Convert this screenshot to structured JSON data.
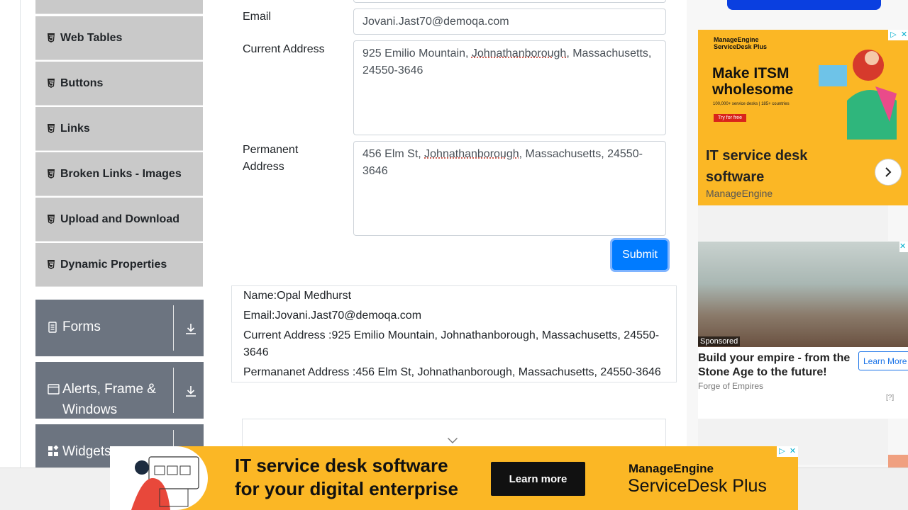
{
  "sidebar": {
    "items": [
      {
        "label": "Web Tables"
      },
      {
        "label": "Buttons"
      },
      {
        "label": "Links"
      },
      {
        "label": "Broken Links - Images"
      },
      {
        "label": "Upload and Download"
      },
      {
        "label": "Dynamic Properties"
      }
    ],
    "groups": [
      {
        "label": "Forms"
      },
      {
        "label": "Alerts, Frame & Windows"
      },
      {
        "label": "Widgets"
      }
    ]
  },
  "form": {
    "email_label": "Email",
    "email_value": "Jovani.Jast70@demoqa.com",
    "current_address_label": "Current Address",
    "current_address_value_pre": "925 Emilio Mountain, ",
    "current_address_value_city": "Johnathanborough",
    "current_address_value_post": ", Massachusetts, 24550-3646",
    "permanent_address_label": "Permanent Address",
    "permanent_address_value_pre": "456 Elm St, ",
    "permanent_address_value_city": "Johnathanborough",
    "permanent_address_value_post": ", Massachusetts, 24550-3646",
    "submit_label": "Submit"
  },
  "output": {
    "name": "Name:Opal Medhurst",
    "email": "Email:Jovani.Jast70@demoqa.com",
    "current_address": "Current Address :925 Emilio Mountain, Johnathanborough, Massachusetts, 24550-3646",
    "permanent_address": "Permananet Address :456 Elm St, Johnathanborough, Massachusetts, 24550-3646"
  },
  "ads": {
    "ad1": {
      "logo_line1": "ManageEngine",
      "logo_line2": "ServiceDesk Plus",
      "headline": "Make ITSM wholesome",
      "tagline": "100,000+ service desks | 185+ countries",
      "cta": "Try for free",
      "title": "IT service desk software",
      "brand": "ManageEngine"
    },
    "ad2": {
      "sponsored": "Sponsored",
      "title": "Build your empire - from the Stone Age to the future!",
      "source": "Forge of Empires",
      "cta": "Learn More",
      "help": "[?]"
    },
    "banner": {
      "line1": "IT service desk software",
      "line2": "for your digital enterprise",
      "cta": "Learn more",
      "logo1": "ManageEngine",
      "logo2": "ServiceDesk Plus"
    },
    "colors": {
      "accent": "#007bff",
      "ad_yellow": "#fbb725",
      "sidebar_group": "#6c7480"
    }
  }
}
